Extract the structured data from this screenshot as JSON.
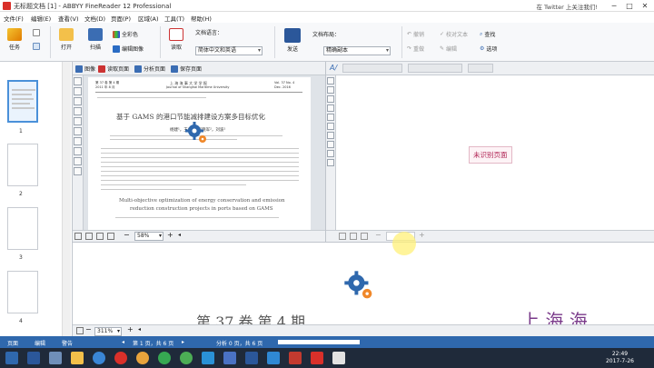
{
  "titlebar": {
    "title": "无标题文档 [1] - ABBYY FineReader 12 Professional",
    "right_text": "在 Twitter 上关注我们!",
    "minimize": "─",
    "maximize": "□",
    "close": "✕"
  },
  "menu": [
    "文件(F)",
    "编辑(E)",
    "查看(V)",
    "文档(D)",
    "页面(P)",
    "区域(A)",
    "工具(T)",
    "帮助(H)"
  ],
  "ribbon": {
    "task": "任务",
    "open": "打开",
    "scan": "扫描",
    "read": "读取",
    "full_color": "全彩色",
    "edit_image": "编辑图像",
    "doc_language_label": "文档语言：",
    "doc_language_value": "简体中文和英语",
    "send": "发送",
    "doc_layout_label": "文档布局：",
    "doc_layout_value": "精确副本",
    "undo": "撤销",
    "redo": "重做",
    "check_text": "校对文本",
    "edit": "编辑",
    "find": "查找",
    "options": "选项"
  },
  "image_toolbar": {
    "image": "图像",
    "read_page": "读取页面",
    "analyze_page": "分析页面",
    "save_page": "保存页面"
  },
  "thumbnails": [
    "1",
    "2",
    "3",
    "4"
  ],
  "page": {
    "header_left": "第 37 卷 第 4 期",
    "header_left2": "2011 年 8 月",
    "header_center": "上 海 海 事 大 学 学 报",
    "header_center2": "Journal of Shanghai Maritime University",
    "header_right": "Vol. 37  No. 4",
    "header_right2": "Dec. 2016",
    "title_cn": "基于 GAMS 的港口节能减排建设方案多目标优化",
    "authors": "杨建¹，王伟¹，吴晓军²，刘波¹",
    "title_en_1": "Multi-objective optimization of energy conservation and emission",
    "title_en_2": "reduction construction projects in ports based on GAMS",
    "zoom": "58%"
  },
  "text_pane": {
    "unrecognized": "未识别页面"
  },
  "zoom_pane": {
    "big_left": "第 37 卷 第 4 期",
    "big_right": "上  海  海",
    "zoom": "311%"
  },
  "status": {
    "pages": "页面",
    "edit": "编辑",
    "alerts": "警告",
    "page_of": "第 1 页，共 6 页",
    "progress": "分析 0 页，共 6 页"
  },
  "clock": {
    "time": "22:49",
    "date": "2017-7-26"
  },
  "colors": {
    "accent_blue": "#2f68ad",
    "unrecognized_text": "#b02152",
    "big_right_text": "#7a3a8a"
  }
}
